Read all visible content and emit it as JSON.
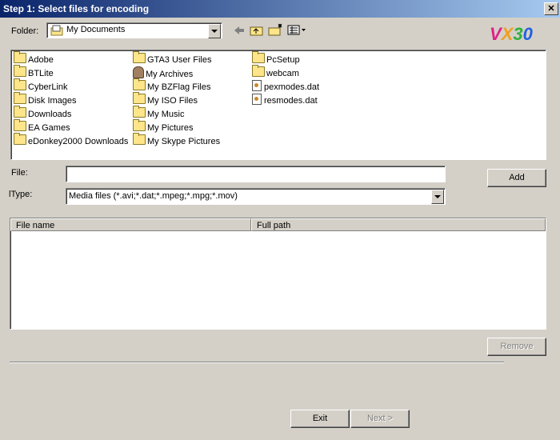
{
  "window": {
    "title": "Step 1: Select files for encoding",
    "close_glyph": "✕"
  },
  "folder": {
    "label": "Folder:",
    "current": "My Documents"
  },
  "toolbar": {
    "back_icon": "back-arrow-icon",
    "up_icon": "up-folder-icon",
    "new_folder_icon": "new-folder-icon",
    "view_icon": "view-menu-icon"
  },
  "logo": {
    "letters": [
      "V",
      "X",
      "3",
      "0"
    ],
    "colors": [
      "#e0208a",
      "#f0a020",
      "#30b040",
      "#2060e0"
    ]
  },
  "files": {
    "col1": [
      {
        "name": "Adobe",
        "type": "folder"
      },
      {
        "name": "BTLite",
        "type": "folder"
      },
      {
        "name": "CyberLink",
        "type": "folder"
      },
      {
        "name": "Disk Images",
        "type": "folder"
      },
      {
        "name": "Downloads",
        "type": "folder"
      },
      {
        "name": "EA Games",
        "type": "folder"
      },
      {
        "name": "eDonkey2000 Downloads",
        "type": "folder"
      }
    ],
    "col2": [
      {
        "name": "GTA3 User Files",
        "type": "folder"
      },
      {
        "name": "My Archives",
        "type": "archive"
      },
      {
        "name": "My BZFlag Files",
        "type": "folder"
      },
      {
        "name": "My ISO Files",
        "type": "folder"
      },
      {
        "name": "My Music",
        "type": "folder"
      },
      {
        "name": "My Pictures",
        "type": "folder"
      },
      {
        "name": "My Skype Pictures",
        "type": "folder"
      }
    ],
    "col3": [
      {
        "name": "PcSetup",
        "type": "folder"
      },
      {
        "name": "webcam",
        "type": "folder"
      },
      {
        "name": "pexmodes.dat",
        "type": "file"
      },
      {
        "name": "resmodes.dat",
        "type": "file"
      }
    ]
  },
  "file_field": {
    "label": "File:",
    "value": ""
  },
  "type_field": {
    "label": "lType:",
    "value": "Media files (*.avi;*.dat;*.mpeg;*.mpg;*.mov)"
  },
  "buttons": {
    "add": "Add",
    "remove": "Remove",
    "exit": "Exit",
    "next": "Next >"
  },
  "table": {
    "headers": [
      "File name",
      "Full path"
    ],
    "rows": []
  }
}
